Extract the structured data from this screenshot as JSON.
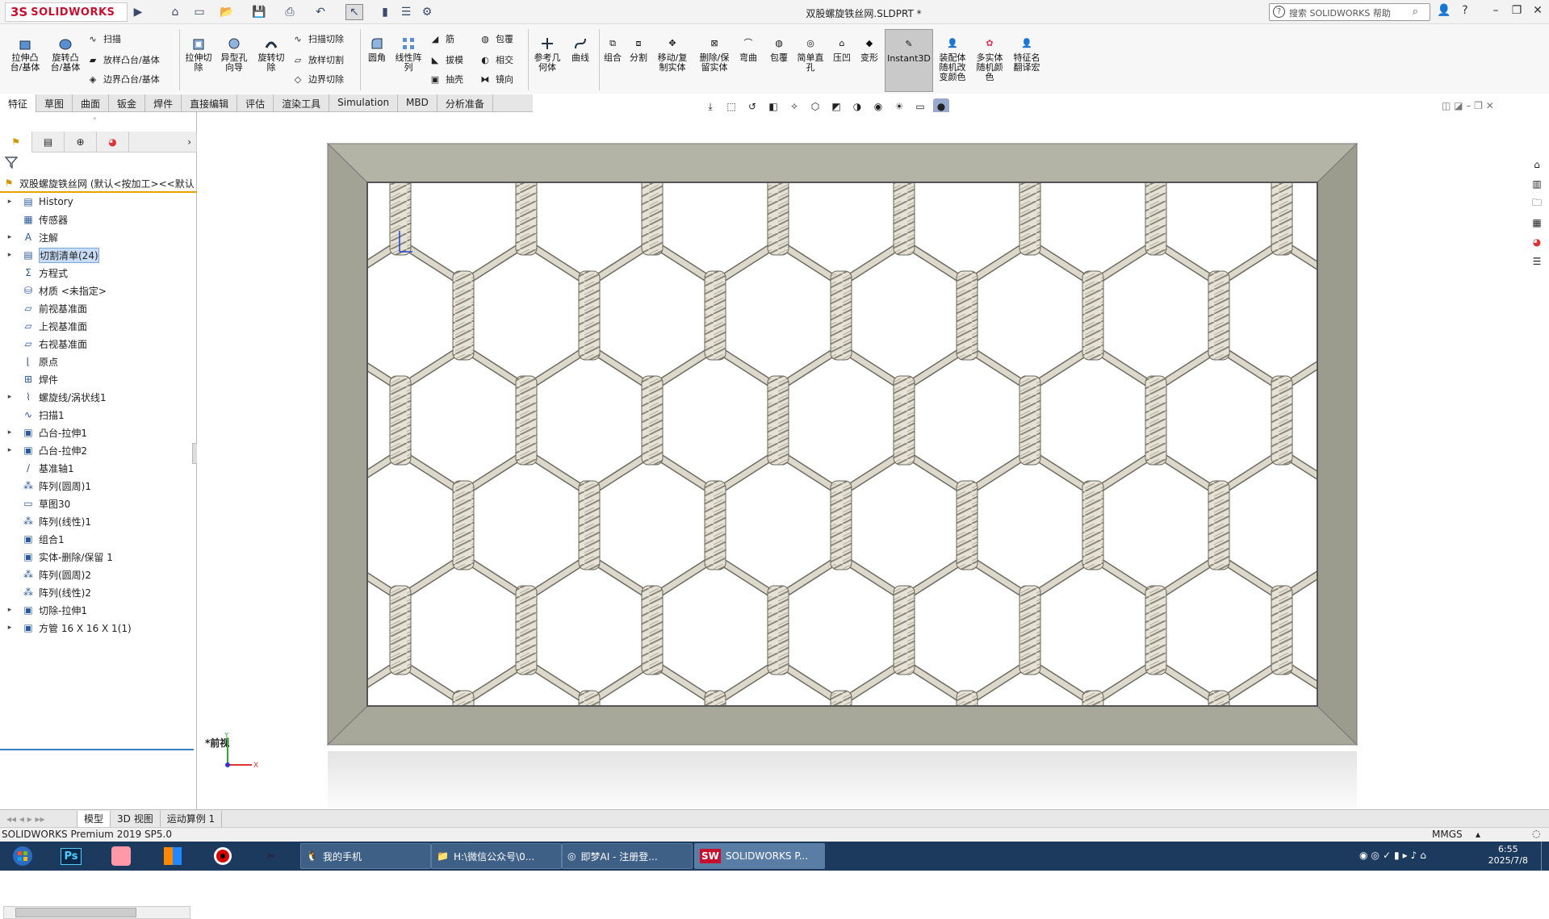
{
  "app": {
    "logo_prefix": "3S",
    "logo_text": "SOLIDWORKS",
    "doc_title": "双股螺旋铁丝网.SLDPRT *"
  },
  "search": {
    "placeholder": "搜索 SOLIDWORKS 帮助"
  },
  "ribbon": {
    "extrude_boss": "拉伸凸\n台/基体",
    "revolve_boss": "旋转凸\n台/基体",
    "sweep": "扫描",
    "loft": "放样凸台/基体",
    "boundary_boss": "边界凸台/基体",
    "extrude_cut": "拉伸切\n除",
    "hole_wizard": "异型孔\n向导",
    "revolve_cut": "旋转切\n除",
    "swept_cut": "扫描切除",
    "lofted_cut": "放样切割",
    "boundary_cut": "边界切除",
    "fillet": "圆角",
    "linear_pattern": "线性阵\n列",
    "rib": "筋",
    "draft": "拔模",
    "shell": "抽壳",
    "wrap": "包覆",
    "intersect": "相交",
    "mirror": "镜向",
    "ref_geometry": "参考几\n何体",
    "curves": "曲线",
    "combine": "组合",
    "split": "分割",
    "move_copy": "移动/复\n制实体",
    "delete_keep": "删除/保\n留实体",
    "flex": "弯曲",
    "wrap2": "包覆",
    "simple_hole": "简单直\n孔",
    "indent": "压凹",
    "deform": "变形",
    "instant3d": "Instant3D",
    "assembly_color": "装配体\n随机改\n变颜色",
    "multibody_color": "多实体\n随机颜\n色",
    "feature_translate": "特征名\n翻译宏"
  },
  "tabs": [
    "特征",
    "草图",
    "曲面",
    "钣金",
    "焊件",
    "直接编辑",
    "评估",
    "渲染工具",
    "Simulation",
    "MBD",
    "分析准备"
  ],
  "tree": {
    "root": "双股螺旋铁丝网 (默认<按加工><<默认",
    "items": [
      {
        "label": "History",
        "exp": "▸"
      },
      {
        "label": "传感器",
        "exp": ""
      },
      {
        "label": "注解",
        "exp": "▸"
      },
      {
        "label": "切割清单(24)",
        "exp": "▸",
        "selected": true
      },
      {
        "label": "方程式",
        "exp": ""
      },
      {
        "label": "材质 <未指定>",
        "exp": ""
      },
      {
        "label": "前视基准面",
        "exp": ""
      },
      {
        "label": "上视基准面",
        "exp": ""
      },
      {
        "label": "右视基准面",
        "exp": ""
      },
      {
        "label": "原点",
        "exp": ""
      },
      {
        "label": "焊件",
        "exp": ""
      },
      {
        "label": "螺旋线/涡状线1",
        "exp": "▸"
      },
      {
        "label": "扫描1",
        "exp": ""
      },
      {
        "label": "凸台-拉伸1",
        "exp": "▸"
      },
      {
        "label": "凸台-拉伸2",
        "exp": "▸"
      },
      {
        "label": "基准轴1",
        "exp": ""
      },
      {
        "label": "阵列(圆周)1",
        "exp": ""
      },
      {
        "label": "草图30",
        "exp": ""
      },
      {
        "label": "阵列(线性)1",
        "exp": ""
      },
      {
        "label": "组合1",
        "exp": ""
      },
      {
        "label": "实体-删除/保留 1",
        "exp": ""
      },
      {
        "label": "阵列(圆周)2",
        "exp": ""
      },
      {
        "label": "阵列(线性)2",
        "exp": ""
      },
      {
        "label": "切除-拉伸1",
        "exp": "▸"
      },
      {
        "label": "方管 16 X 16 X 1(1)",
        "exp": "▸"
      }
    ]
  },
  "viewport": {
    "view_label": "*前视"
  },
  "bottom_tabs": [
    "模型",
    "3D 视图",
    "运动算例 1"
  ],
  "status": {
    "left": "SOLIDWORKS Premium 2019 SP5.0",
    "units": "MMGS"
  },
  "taskbar": {
    "windows": [
      "我的手机",
      "H:\\微信公众号\\0...",
      "即梦AI - 注册登...",
      "SOLIDWORKS P..."
    ],
    "time": "6:55",
    "date": "2025/7/8"
  },
  "colors": {
    "frame": "#a3a395",
    "wire": "#dcd8cc",
    "accent": "#c8102e",
    "taskbar": "#1c3a5e"
  }
}
